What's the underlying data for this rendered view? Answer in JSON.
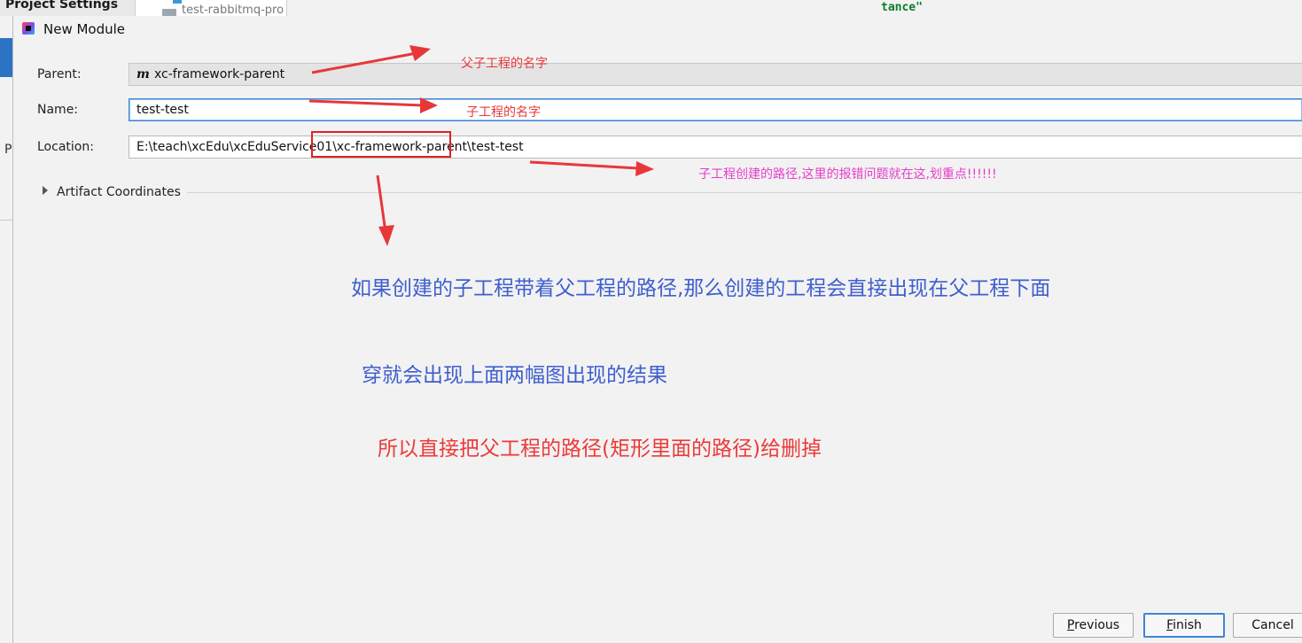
{
  "background": {
    "project_settings": "Project Settings",
    "tree_item": "test-rabbitmq-pro",
    "code_fragment": "tance\"",
    "left_letter": "P"
  },
  "dialog": {
    "title": "New Module",
    "parent_label": "Parent:",
    "parent_value": "xc-framework-parent",
    "parent_icon": "m",
    "name_label": "Name:",
    "name_value": "test-test",
    "location_label": "Location:",
    "location_value": "E:\\teach\\xcEdu\\xcEduService01\\xc-framework-parent\\test-test",
    "artifact_label": "Artifact Coordinates"
  },
  "annotations": {
    "parent_note": "父子工程的名字",
    "name_note": "子工程的名字",
    "location_note": "子工程创建的路径,这里的报错问题就在这,划重点!!!!!!",
    "line1": "如果创建的子工程带着父工程的路径,那么创建的工程会直接出现在父工程下面",
    "line2": "穿就会出现上面两幅图出现的结果",
    "line3": "所以直接把父工程的路径(矩形里面的路径)给删掉"
  },
  "buttons": {
    "previous_mnemonic": "P",
    "previous_rest": "revious",
    "finish_mnemonic": "F",
    "finish_rest": "inish",
    "cancel": "Cancel"
  },
  "colors": {
    "annotation_red": "#e8373a",
    "annotation_magenta": "#e53ecb",
    "annotation_blue": "#3f5fce",
    "focus_blue": "#3d86d6"
  }
}
